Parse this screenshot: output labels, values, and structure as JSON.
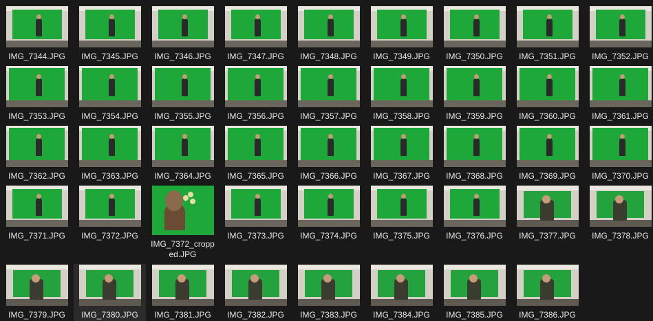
{
  "files": [
    {
      "name": "IMG_7344.JPG"
    },
    {
      "name": "IMG_7345.JPG"
    },
    {
      "name": "IMG_7346.JPG"
    },
    {
      "name": "IMG_7347.JPG"
    },
    {
      "name": "IMG_7348.JPG"
    },
    {
      "name": "IMG_7349.JPG"
    },
    {
      "name": "IMG_7350.JPG"
    },
    {
      "name": "IMG_7351.JPG"
    },
    {
      "name": "IMG_7352.JPG"
    },
    {
      "name": "IMG_7353.JPG"
    },
    {
      "name": "IMG_7354.JPG"
    },
    {
      "name": "IMG_7355.JPG"
    },
    {
      "name": "IMG_7356.JPG"
    },
    {
      "name": "IMG_7357.JPG"
    },
    {
      "name": "IMG_7358.JPG"
    },
    {
      "name": "IMG_7359.JPG"
    },
    {
      "name": "IMG_7360.JPG"
    },
    {
      "name": "IMG_7361.JPG"
    },
    {
      "name": "IMG_7362.JPG"
    },
    {
      "name": "IMG_7363.JPG"
    },
    {
      "name": "IMG_7364.JPG"
    },
    {
      "name": "IMG_7365.JPG"
    },
    {
      "name": "IMG_7366.JPG"
    },
    {
      "name": "IMG_7367.JPG"
    },
    {
      "name": "IMG_7368.JPG"
    },
    {
      "name": "IMG_7369.JPG"
    },
    {
      "name": "IMG_7370.JPG"
    },
    {
      "name": "IMG_7371.JPG"
    },
    {
      "name": "IMG_7372.JPG"
    },
    {
      "name": "IMG_7372_cropped.JPG"
    },
    {
      "name": "IMG_7373.JPG"
    },
    {
      "name": "IMG_7374.JPG"
    },
    {
      "name": "IMG_7375.JPG"
    },
    {
      "name": "IMG_7376.JPG"
    },
    {
      "name": "IMG_7377.JPG"
    },
    {
      "name": "IMG_7378.JPG"
    },
    {
      "name": "IMG_7379.JPG"
    },
    {
      "name": "IMG_7380.JPG"
    },
    {
      "name": "IMG_7381.JPG"
    },
    {
      "name": "IMG_7382.JPG"
    },
    {
      "name": "IMG_7383.JPG"
    },
    {
      "name": "IMG_7384.JPG"
    },
    {
      "name": "IMG_7385.JPG"
    },
    {
      "name": "IMG_7386.JPG"
    }
  ],
  "colors": {
    "background": "#191919",
    "text": "#e6e6e6",
    "green_screen": "#1fa83a",
    "hover": "#2b2b2b"
  }
}
